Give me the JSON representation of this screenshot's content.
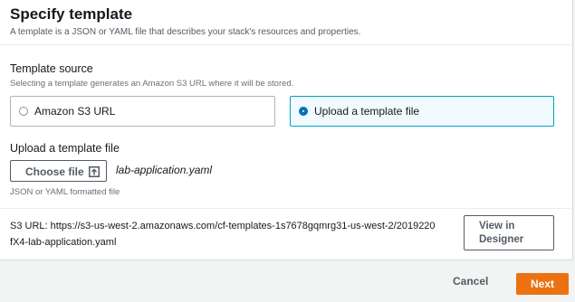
{
  "header": {
    "title": "Specify template",
    "subtitle": "A template is a JSON or YAML file that describes your stack's resources and properties."
  },
  "template_source": {
    "label": "Template source",
    "description": "Selecting a template generates an Amazon S3 URL where it will be stored.",
    "options": [
      {
        "label": "Amazon S3 URL",
        "selected": false
      },
      {
        "label": "Upload a template file",
        "selected": true
      }
    ]
  },
  "upload": {
    "label": "Upload a template file",
    "choose_button": "Choose file",
    "choose_icon": "upload-icon",
    "file_name": "lab-application.yaml",
    "hint": "JSON or YAML formatted file"
  },
  "s3": {
    "url_line1": "S3 URL:  https://s3-us-west-2.amazonaws.com/cf-templates-1s7678gqmrg31-us-west-2/2019220",
    "url_line2": "fX4-lab-application.yaml",
    "designer_button": "View in Designer"
  },
  "footer": {
    "cancel": "Cancel",
    "next": "Next"
  },
  "colors": {
    "accent": "#ec7211",
    "selected_border": "#00a1c9",
    "radio_selected": "#0073bb"
  }
}
